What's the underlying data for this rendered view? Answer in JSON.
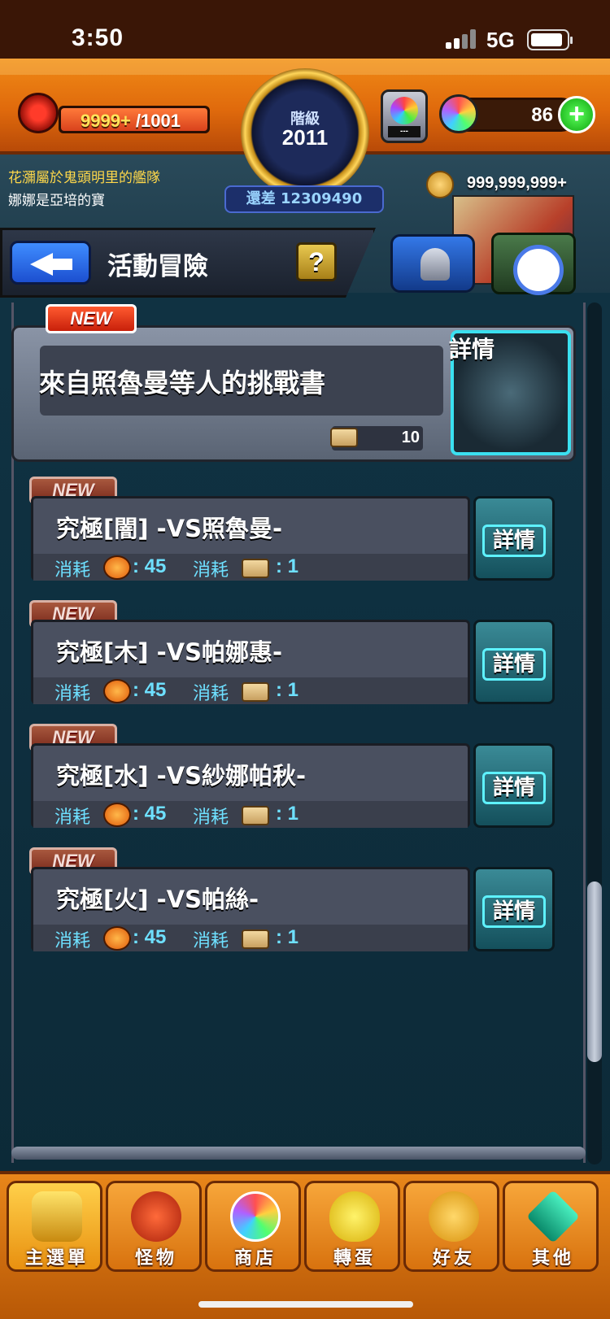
{
  "status_bar": {
    "time": "3:50",
    "network": "5G"
  },
  "hud": {
    "stamina_value": "9999+",
    "stamina_max": "/1001",
    "stamina_fill": 1.0,
    "rank_label": "階級",
    "rank_value": "2011",
    "rank_diff": "還差 12309490",
    "gacha_placeholder": "---",
    "orb_count": "86",
    "plus_label": "+"
  },
  "banner": {
    "notice_line1": "花瀰屬於鬼頭明里的艦隊",
    "notice_line2": "娜娜是亞培的寶",
    "coin_count": "999,999,999+"
  },
  "nav": {
    "page_title": "活動冒險",
    "help_label": "?"
  },
  "featured": {
    "badge": "NEW",
    "title": "來自照魯曼等人的挑戰書",
    "ticket_count": "10",
    "detail_label": "詳情"
  },
  "quests": [
    {
      "badge": "NEW",
      "title": "究極[闇] -ᐯS照魯曼-",
      "cost_label": "消耗",
      "stamina_cost": ": 45",
      "ticket_cost": ": 1",
      "detail_label": "詳情"
    },
    {
      "badge": "NEW",
      "title": "究極[木] -ᐯS帕娜惠-",
      "cost_label": "消耗",
      "stamina_cost": ": 45",
      "ticket_cost": ": 1",
      "detail_label": "詳情"
    },
    {
      "badge": "NEW",
      "title": "究極[水] -ᐯS紗娜帕秋-",
      "cost_label": "消耗",
      "stamina_cost": ": 45",
      "ticket_cost": ": 1",
      "detail_label": "詳情"
    },
    {
      "badge": "NEW",
      "title": "究極[火] -ᐯS帕絲-",
      "cost_label": "消耗",
      "stamina_cost": ": 45",
      "ticket_cost": ": 1",
      "detail_label": "詳情"
    }
  ],
  "scroll_position": 0.85,
  "bottom_nav": [
    {
      "label": "主選單",
      "icon": "castle-icon",
      "active": true
    },
    {
      "label": "怪物",
      "icon": "monster-icon",
      "active": false
    },
    {
      "label": "商店",
      "icon": "rainbow-orb-icon",
      "active": false
    },
    {
      "label": "轉蛋",
      "icon": "egg-icon",
      "active": false
    },
    {
      "label": "好友",
      "icon": "friends-icon",
      "active": false
    },
    {
      "label": "其他",
      "icon": "diamond-icon",
      "active": false
    }
  ],
  "colors": {
    "accent_cyan": "#6ee0ff",
    "hud_orange": "#e06a0c",
    "new_red": "#c8200a"
  }
}
